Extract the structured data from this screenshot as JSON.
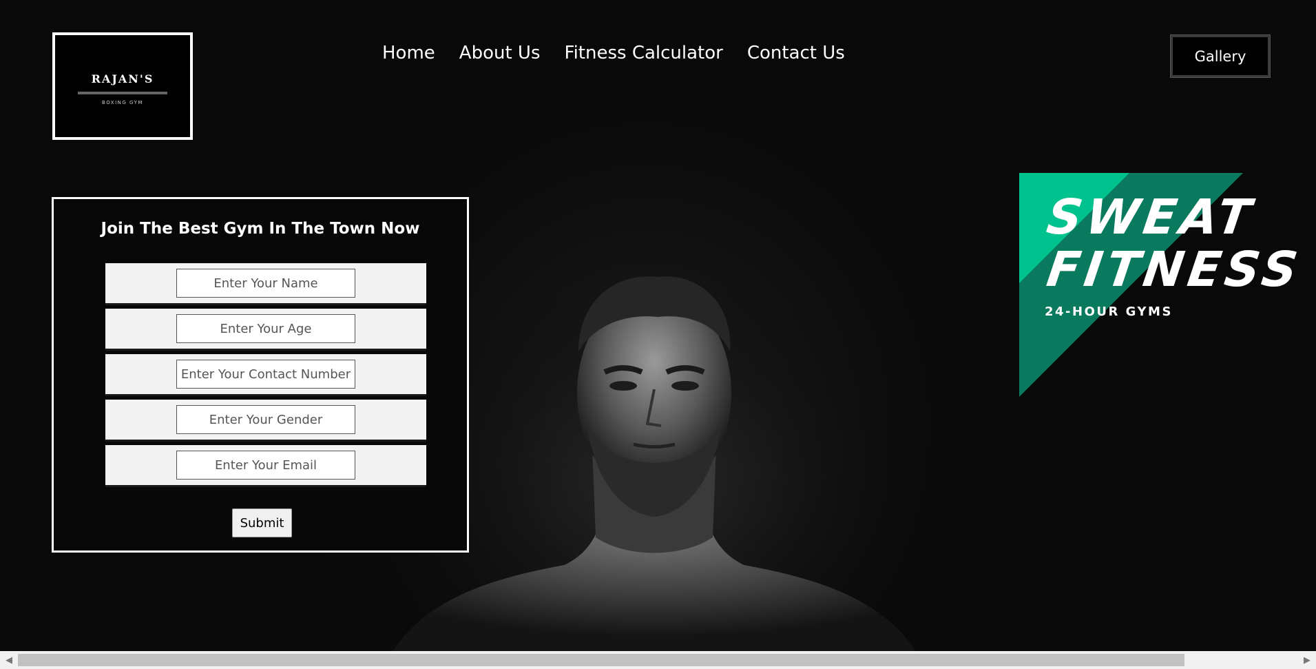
{
  "logo": {
    "title": "RAJAN'S",
    "subtitle": "BOXING GYM"
  },
  "nav": {
    "items": [
      {
        "label": "Home"
      },
      {
        "label": "About Us"
      },
      {
        "label": "Fitness Calculator"
      },
      {
        "label": "Contact Us"
      }
    ],
    "gallery_label": "Gallery"
  },
  "form": {
    "title": "Join The Best Gym In The Town Now",
    "fields": [
      {
        "placeholder": "Enter Your Name",
        "value": ""
      },
      {
        "placeholder": "Enter Your Age",
        "value": ""
      },
      {
        "placeholder": "Enter Your Contact Number",
        "value": ""
      },
      {
        "placeholder": "Enter Your Gender",
        "value": ""
      },
      {
        "placeholder": "Enter Your Email",
        "value": ""
      }
    ],
    "submit_label": "Submit"
  },
  "brand": {
    "line1": "SWEAT",
    "line2": "FITNESS",
    "line3": "24-HOUR GYMS",
    "colors": {
      "light": "#00c28e",
      "dark": "#0a7a5e"
    }
  },
  "scrollbar": {
    "left_arrow": "◀",
    "right_arrow": "▶"
  }
}
